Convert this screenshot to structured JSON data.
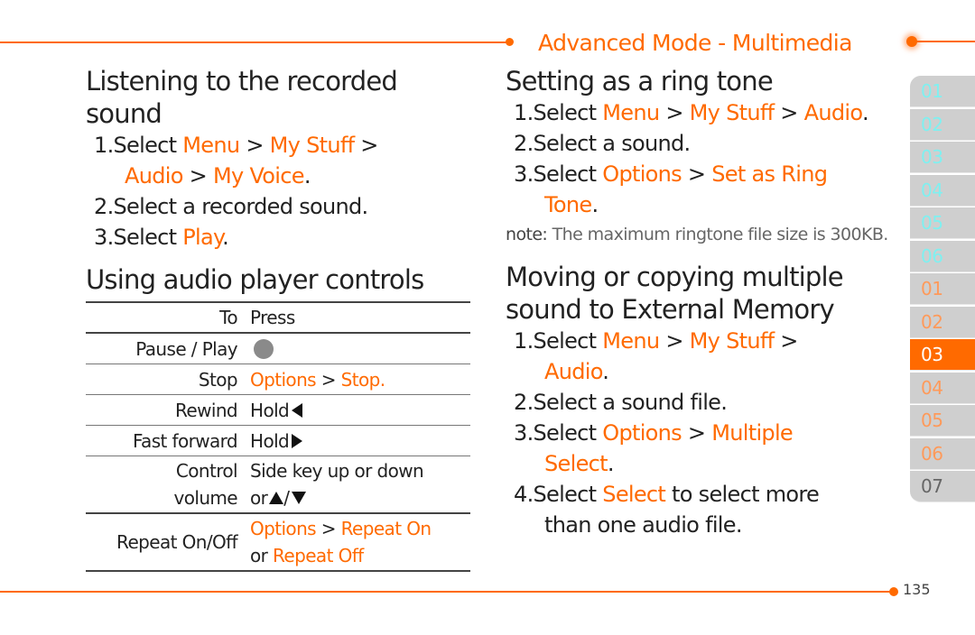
{
  "header": {
    "section_title": "Advanced Mode - Multimedia"
  },
  "colors": {
    "accent": "#ff6a00",
    "text": "#222222",
    "tab_bg": "#cfcfcf",
    "tab_active_bg": "#ff6a00"
  },
  "listening": {
    "title": "Listening to the recorded sound",
    "steps": [
      {
        "num": "1.",
        "parts": [
          "Select ",
          "Menu",
          " > ",
          "My Stuff",
          " >"
        ],
        "cont": [
          "Audio",
          " > ",
          "My Voice",
          "."
        ]
      },
      {
        "num": "2.",
        "text": "Select a recorded sound."
      },
      {
        "num": "3.",
        "parts": [
          "Select ",
          "Play",
          "."
        ]
      }
    ]
  },
  "controls": {
    "title": "Using audio player controls",
    "headers": {
      "to": "To",
      "press": "Press"
    },
    "rows": [
      {
        "to": "Pause / Play",
        "press_icon": "center-key-icon"
      },
      {
        "to": "Stop",
        "press": [
          "Options",
          " > ",
          "Stop."
        ]
      },
      {
        "to": "Rewind",
        "press_text": "Hold",
        "press_icon": "left-arrow-icon"
      },
      {
        "to": "Fast forward",
        "press_text": "Hold",
        "press_icon": "right-arrow-icon"
      },
      {
        "to_line1": "Control",
        "to_line2": "volume",
        "press_line1": "Side key up or down",
        "press_line2": "or",
        "press_icon": "up-down-arrow-icon"
      },
      {
        "to": "Repeat On/Off",
        "press_line1": [
          "Options",
          " > ",
          "Repeat On"
        ],
        "press_line2": [
          "or ",
          "Repeat Off"
        ]
      }
    ]
  },
  "ringtone": {
    "title": "Setting as a ring tone",
    "steps": [
      {
        "num": "1.",
        "parts": [
          "Select ",
          "Menu",
          " > ",
          "My Stuff",
          " > ",
          "Audio",
          "."
        ]
      },
      {
        "num": "2.",
        "text": "Select a sound."
      },
      {
        "num": "3.",
        "parts": [
          "Select ",
          "Options",
          " > ",
          "Set as Ring"
        ],
        "cont": [
          "Tone",
          "."
        ]
      }
    ],
    "note_label": "note:",
    "note_text": " The maximum ringtone file size is 300KB."
  },
  "moving": {
    "title_line1": "Moving or copying multiple",
    "title_line2": "sound to External Memory",
    "steps": [
      {
        "num": "1.",
        "parts": [
          "Select ",
          "Menu",
          " > ",
          "My Stuff",
          " >"
        ],
        "cont": [
          "Audio",
          "."
        ]
      },
      {
        "num": "2.",
        "text": "Select a sound file."
      },
      {
        "num": "3.",
        "parts": [
          "Select ",
          "Options",
          " > ",
          "Multiple"
        ],
        "cont": [
          "Select",
          "."
        ]
      },
      {
        "num": "4.",
        "parts": [
          "Select ",
          "Select",
          " to select more"
        ],
        "cont_text": "than one audio file."
      }
    ]
  },
  "side_tabs": [
    {
      "label": "01",
      "style": "cyan"
    },
    {
      "label": "02",
      "style": "cyan"
    },
    {
      "label": "03",
      "style": "cyan"
    },
    {
      "label": "04",
      "style": "cyan"
    },
    {
      "label": "05",
      "style": "cyan"
    },
    {
      "label": "06",
      "style": "cyan"
    },
    {
      "label": "01",
      "style": "orange"
    },
    {
      "label": "02",
      "style": "orange"
    },
    {
      "label": "03",
      "style": "active"
    },
    {
      "label": "04",
      "style": "orange"
    },
    {
      "label": "05",
      "style": "orange"
    },
    {
      "label": "06",
      "style": "orange"
    },
    {
      "label": "07",
      "style": "gray"
    }
  ],
  "footer": {
    "page_number": "135"
  }
}
